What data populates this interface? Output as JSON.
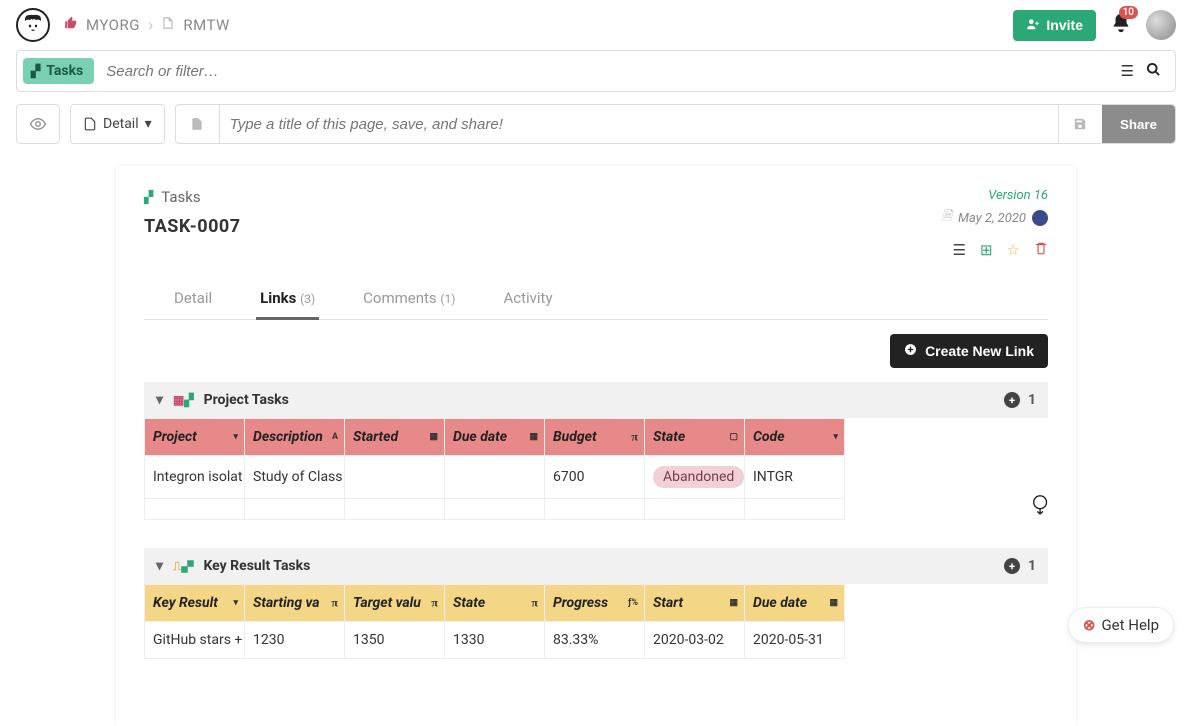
{
  "breadcrumb": {
    "org": "MYORG",
    "project": "RMTW"
  },
  "header": {
    "invite_label": "Invite",
    "notification_count": "10"
  },
  "search": {
    "pill_label": "Tasks",
    "placeholder": "Search or filter…"
  },
  "toolbar": {
    "detail_label": "Detail",
    "title_placeholder": "Type a title of this page, save, and share!",
    "share_label": "Share"
  },
  "card": {
    "crumb": "Tasks",
    "task_name": "TASK-0007",
    "version": "Version 16",
    "date": "May 2, 2020"
  },
  "tabs": {
    "detail": "Detail",
    "links": "Links",
    "links_count": "(3)",
    "comments": "Comments",
    "comments_count": "(1)",
    "activity": "Activity"
  },
  "create_label": "Create New Link",
  "group1": {
    "title": "Project Tasks",
    "count": "1",
    "columns": {
      "c0": "Project",
      "c1": "Description",
      "c2": "Started",
      "c3": "Due date",
      "c4": "Budget",
      "c5": "State",
      "c6": "Code"
    },
    "rows": [
      {
        "project": "Integron isolat",
        "description": "Study of Class",
        "started": "",
        "due": "",
        "budget": "6700",
        "state": "Abandoned",
        "code": "INTGR"
      }
    ]
  },
  "group2": {
    "title": "Key Result Tasks",
    "count": "1",
    "columns": {
      "c0": "Key Result",
      "c1": "Starting va",
      "c2": "Target valu",
      "c3": "State",
      "c4": "Progress",
      "c5": "Start",
      "c6": "Due date"
    },
    "rows": [
      {
        "kr": "GitHub stars +",
        "start_v": "1230",
        "target_v": "1350",
        "state": "1330",
        "progress": "83.33%",
        "start": "2020-03-02",
        "due": "2020-05-31"
      }
    ]
  },
  "help_label": "Get Help"
}
